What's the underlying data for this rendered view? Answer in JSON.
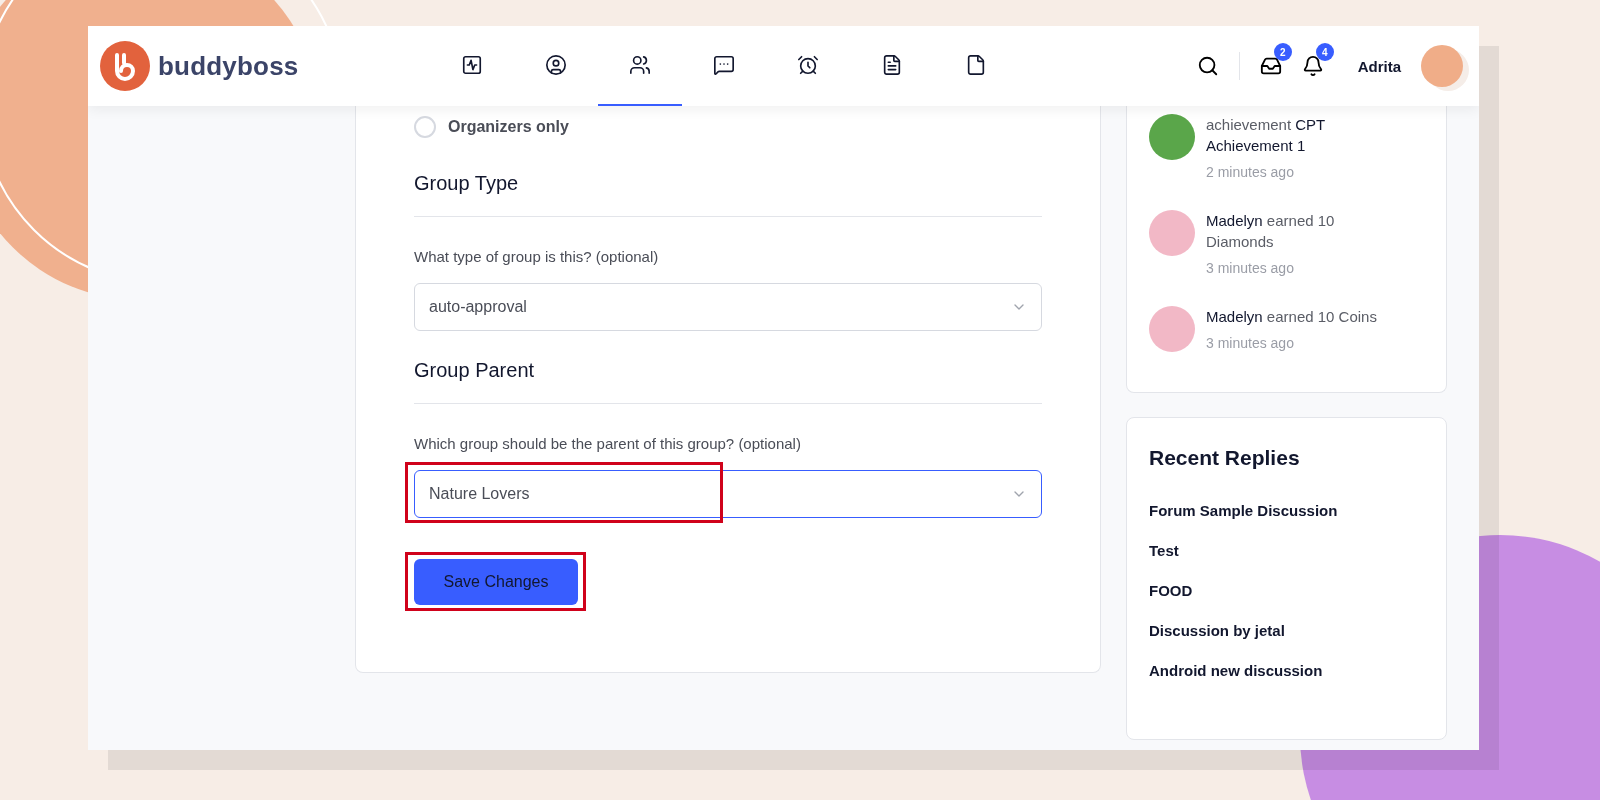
{
  "header": {
    "logo_text": "buddyboss",
    "nav": [
      {
        "kind": "activity",
        "selected": false
      },
      {
        "kind": "profile",
        "selected": false
      },
      {
        "kind": "groups",
        "selected": true
      },
      {
        "kind": "messages",
        "selected": false
      },
      {
        "kind": "alarm",
        "selected": false
      },
      {
        "kind": "document",
        "selected": false
      },
      {
        "kind": "page",
        "selected": false
      }
    ],
    "inbox_count": "2",
    "notification_count": "4",
    "user_name": "Adrita"
  },
  "form": {
    "radio": {
      "label": "Organizers only",
      "selected": false
    },
    "sections": [
      {
        "title": "Group Type",
        "label": "What type of group is this? (optional)",
        "value": "auto-approval",
        "focused": false,
        "highlighted": false
      },
      {
        "title": "Group Parent",
        "label": "Which group should be the parent of this group? (optional)",
        "value": "Nature Lovers",
        "focused": true,
        "highlighted": true
      }
    ],
    "save_button": {
      "label": "Save Changes",
      "highlighted": true
    }
  },
  "activity_feed": [
    {
      "text": "achievement **CPT Achievement 1**",
      "time": "2 minutes ago",
      "color": "#5aa64a"
    },
    {
      "text": "**Madelyn** earned 10 Diamonds",
      "time": "3 minutes ago",
      "color": "#f2b8c6"
    },
    {
      "text": "**Madelyn** earned 10 Coins",
      "time": "3 minutes ago",
      "color": "#f2b8c6"
    }
  ],
  "recent_replies": {
    "title": "Recent Replies",
    "items": [
      "Forum Sample Discussion",
      "Test",
      "FOOD",
      "Discussion by jetal",
      "Android new discussion"
    ]
  }
}
